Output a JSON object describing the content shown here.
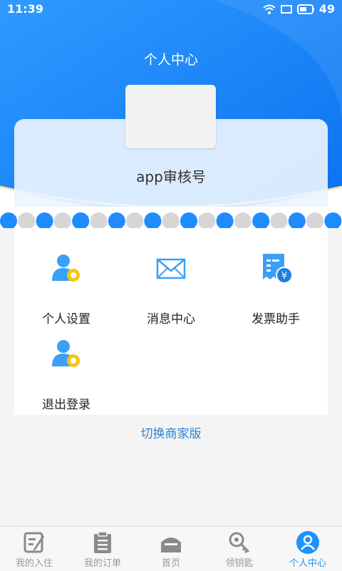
{
  "status": {
    "time": "11:39",
    "battery": "49"
  },
  "header": {
    "title": "个人中心"
  },
  "profile": {
    "name": "app审核号"
  },
  "menu": {
    "items": [
      {
        "label": "个人设置",
        "icon": "user-settings-icon"
      },
      {
        "label": "消息中心",
        "icon": "envelope-icon"
      },
      {
        "label": "发票助手",
        "icon": "invoice-icon"
      },
      {
        "label": "退出登录",
        "icon": "user-logout-icon"
      }
    ]
  },
  "switch_link": "切换商家版",
  "tabs": [
    {
      "label": "我的入住",
      "icon": "edit-note-icon"
    },
    {
      "label": "我的订单",
      "icon": "clipboard-icon"
    },
    {
      "label": "首页",
      "icon": "home-icon"
    },
    {
      "label": "领钥匙",
      "icon": "key-icon"
    },
    {
      "label": "个人中心",
      "icon": "person-icon",
      "active": true
    }
  ],
  "colors": {
    "primary": "#1e8bff",
    "accent_yellow": "#f5c518",
    "text_dark": "#222222",
    "link": "#2b83d6",
    "tab_inactive": "#9a9a9a"
  }
}
